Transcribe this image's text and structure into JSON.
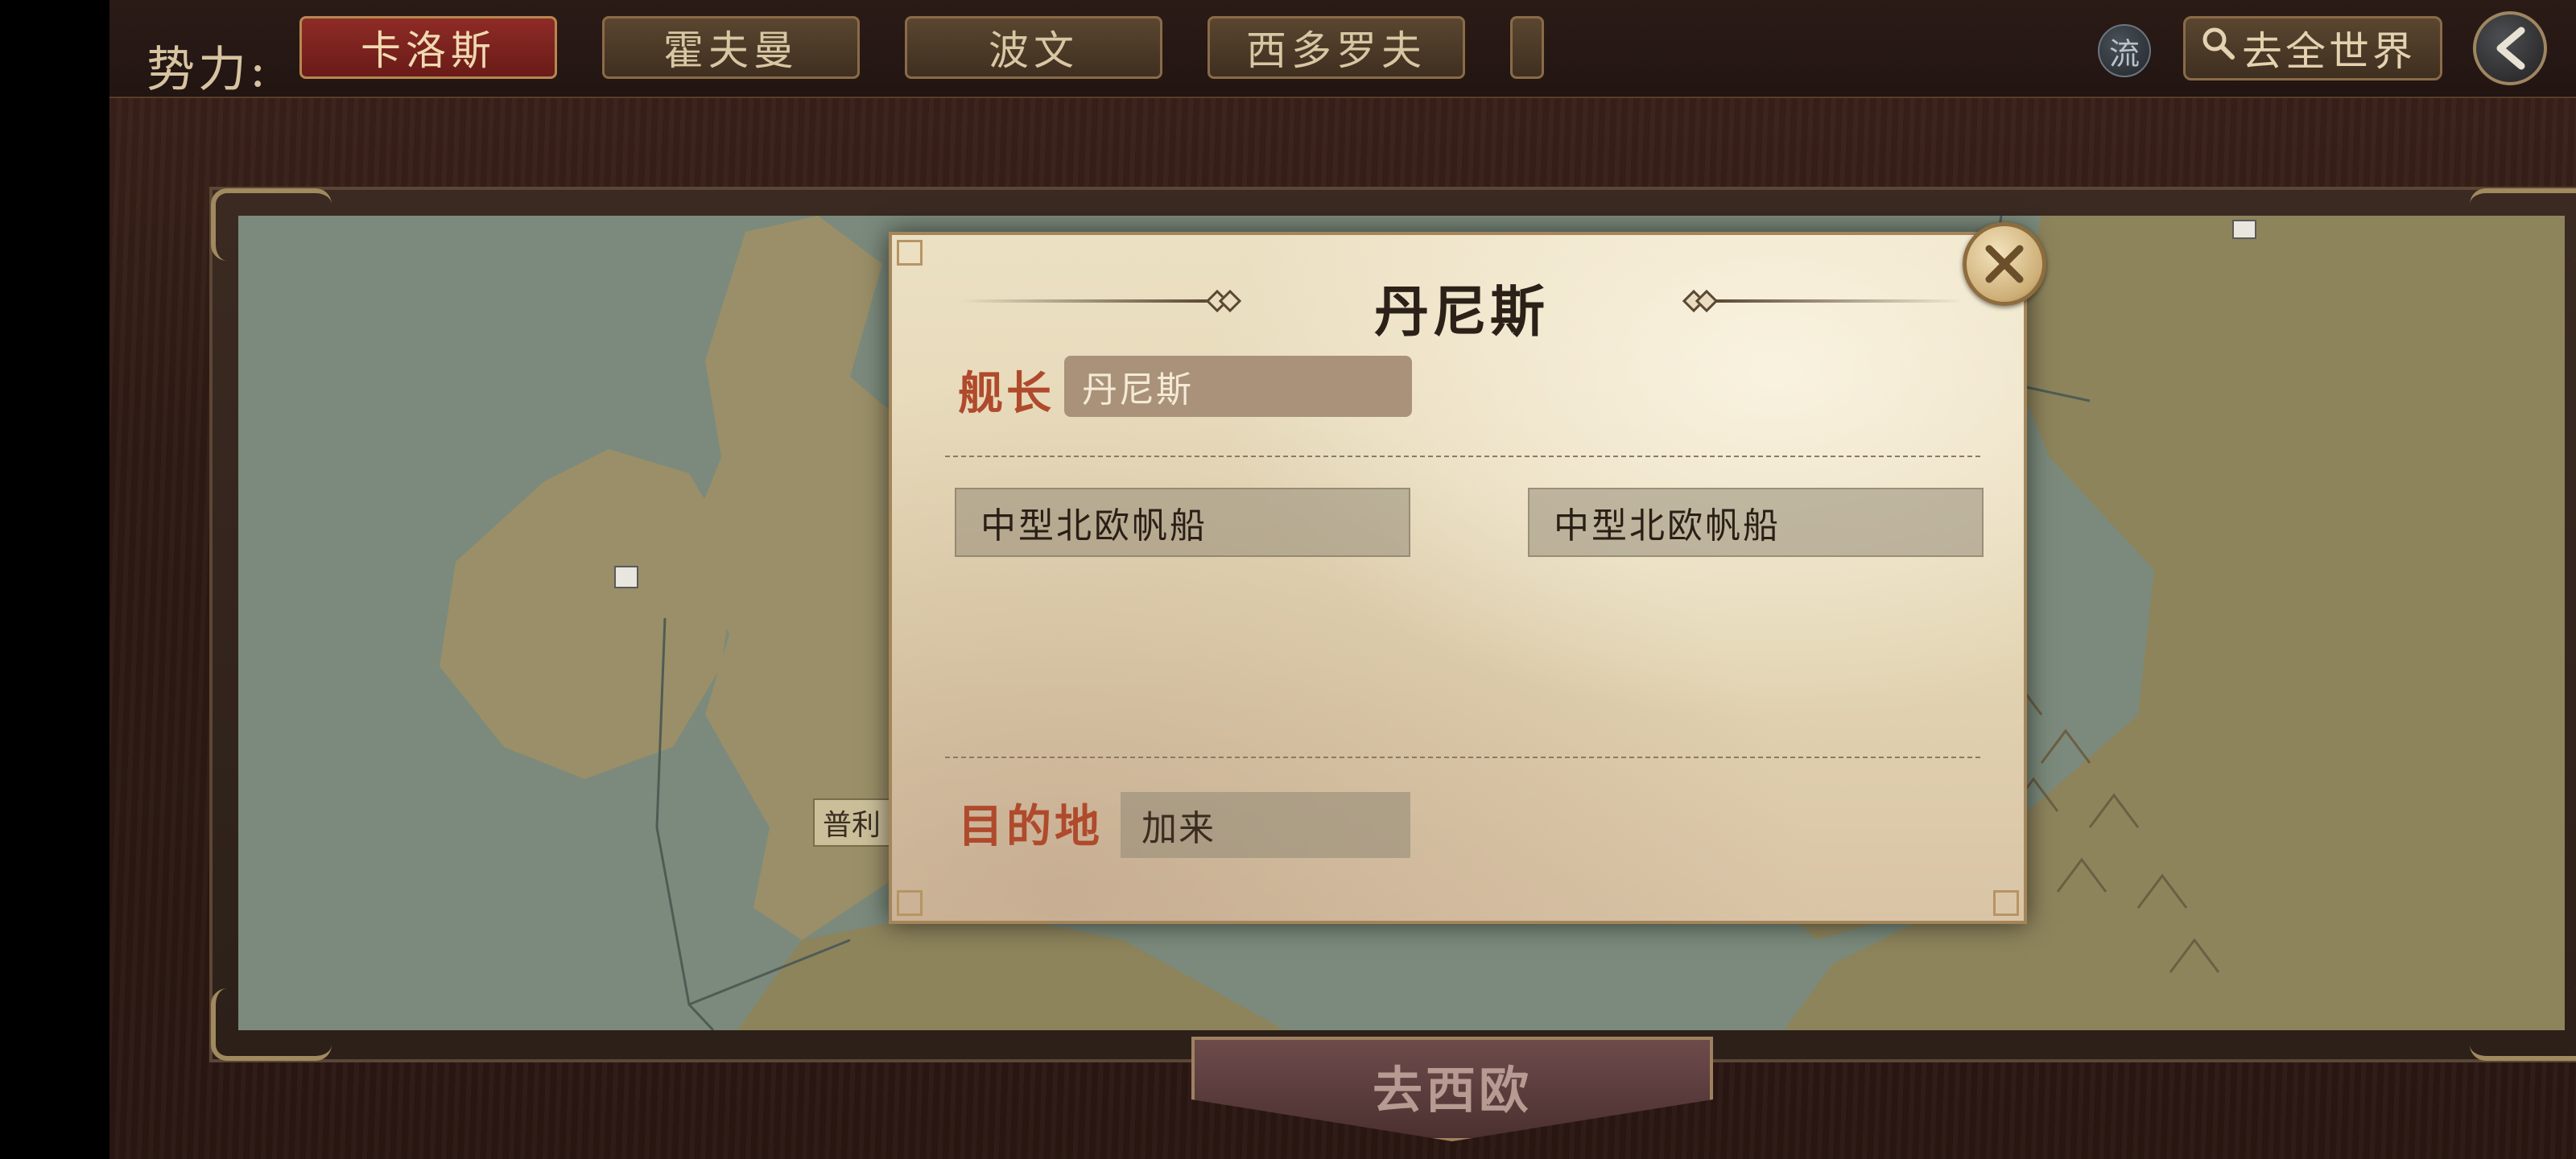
{
  "topbar": {
    "faction_label": "势力:",
    "factions": [
      {
        "label": "卡洛斯",
        "active": true
      },
      {
        "label": "霍夫曼",
        "active": false
      },
      {
        "label": "波文",
        "active": false
      },
      {
        "label": "西多罗夫",
        "active": false
      }
    ],
    "flow_label": "流",
    "search_world_label": "去全世界",
    "search_icon": "search-icon",
    "back_icon": "chevron-left-icon"
  },
  "map": {
    "city_label": "普利",
    "region_button": "去西欧"
  },
  "popup": {
    "title": "丹尼斯",
    "captain_label": "舰长",
    "captain_value": "丹尼斯",
    "ships": [
      "中型北欧帆船",
      "中型北欧帆船"
    ],
    "destination_label": "目的地",
    "destination_value": "加来",
    "close_icon": "close-icon"
  },
  "colors": {
    "accent_red": "#b04a2c",
    "active_tab": "#8e2b26",
    "gold_border": "#a4855a"
  }
}
